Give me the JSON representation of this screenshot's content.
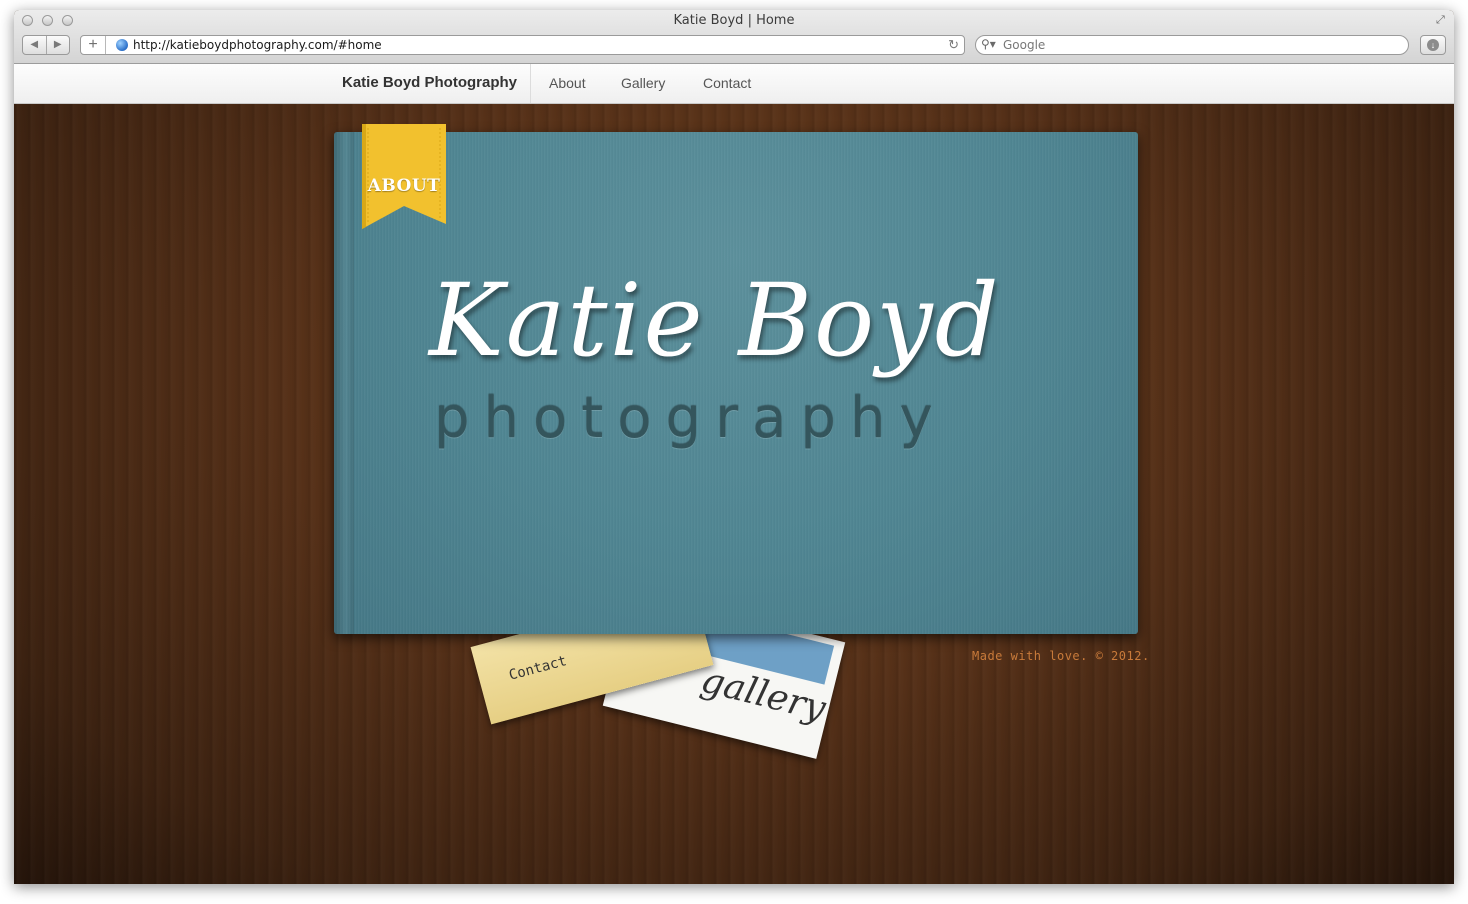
{
  "browser": {
    "window_title": "Katie Boyd | Home",
    "url": "http://katieboydphotography.com/#home",
    "search_placeholder": "Google",
    "icons": [
      "back-icon",
      "forward-icon",
      "add-tab-icon",
      "globe-icon",
      "reload-icon",
      "search-icon",
      "download-icon",
      "fullscreen-icon"
    ]
  },
  "site_nav": {
    "brand": "Katie Boyd Photography",
    "links": [
      {
        "label": "About"
      },
      {
        "label": "Gallery"
      },
      {
        "label": "Contact"
      }
    ]
  },
  "hero": {
    "ribbon_label": "ABOUT",
    "title": "Katie Boyd",
    "subtitle": "photography"
  },
  "cards": {
    "contact_label": "Contact",
    "gallery_label": "gallery"
  },
  "footer": {
    "note": "Made with love. © 2012."
  },
  "colors": {
    "ribbon": "#f2c12e",
    "book": "#4f8592",
    "wood": "#553018",
    "footer_note": "#c87a3a"
  }
}
